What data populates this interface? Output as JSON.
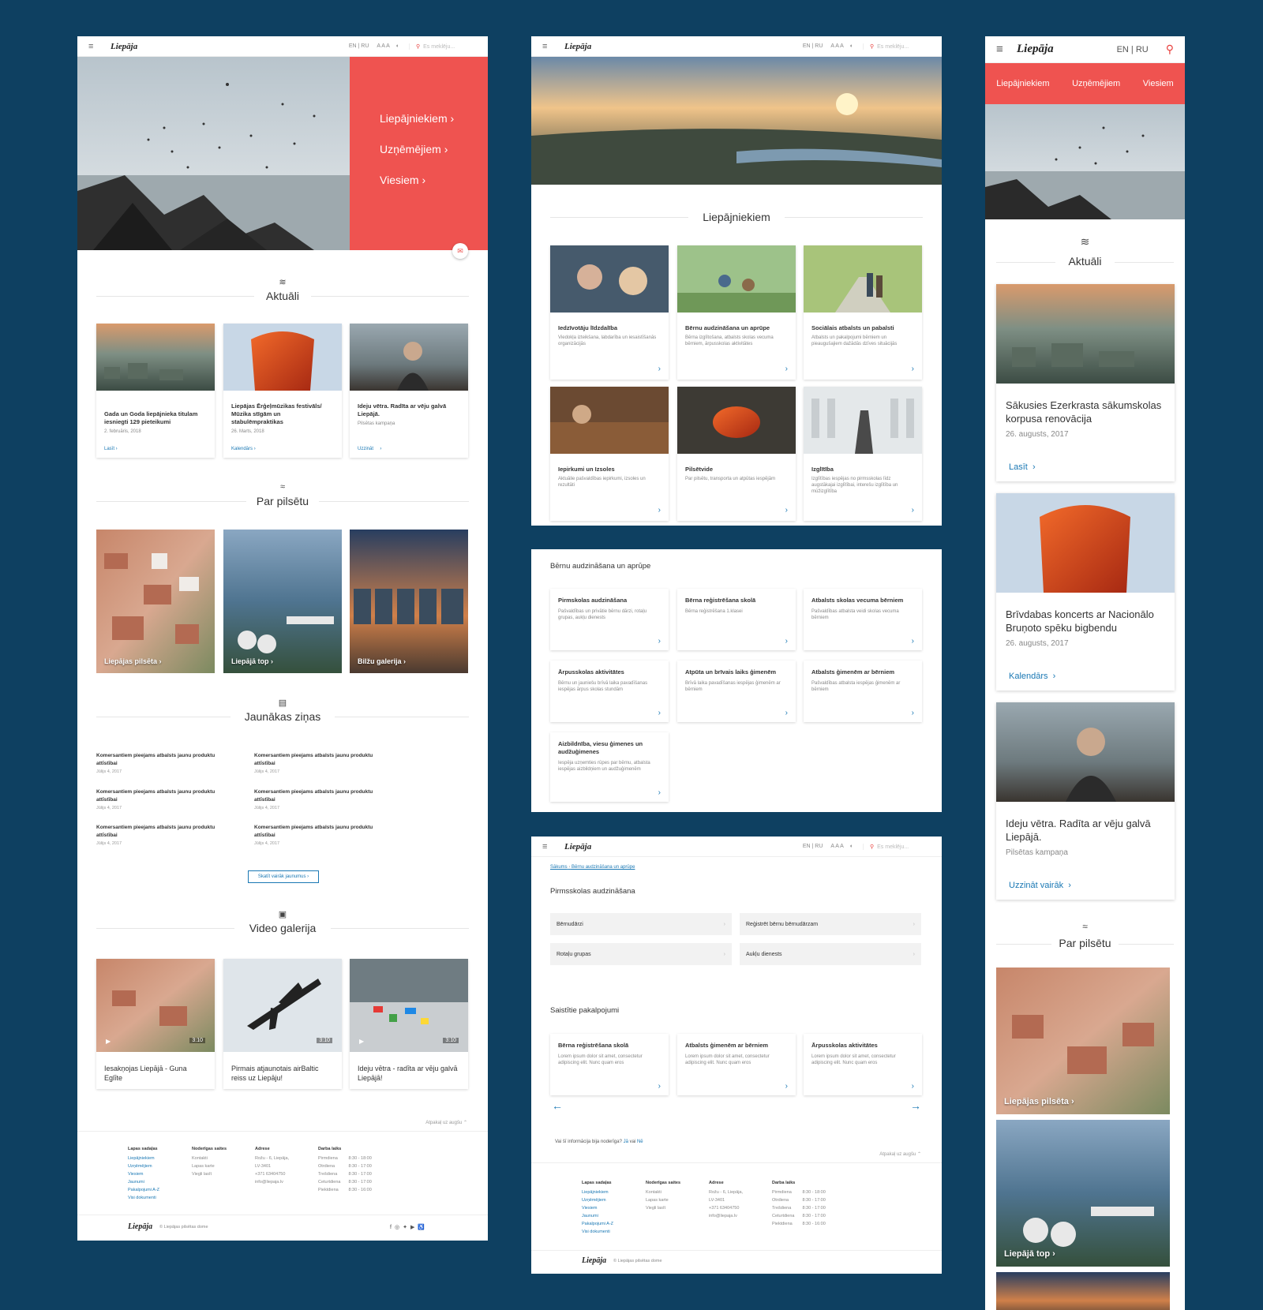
{
  "common": {
    "logo": "Liepāja",
    "lang_en": "EN",
    "lang_ru": "RU",
    "aaa": "A A A",
    "search_placeholder": "Es meklēju..."
  },
  "colors": {
    "accent": "#ef5350",
    "link": "#1a78b4",
    "background": "#0e4061"
  },
  "board1": {
    "hero_nav": [
      "Liepājniekiem",
      "Uzņēmējiem",
      "Viesiem"
    ],
    "aktuali_title": "Aktuāli",
    "aktuali_cards": [
      {
        "title": "Gada un Goda liepājnieka titulam iesniegti 129 pieteikumi",
        "date": "2. februāris, 2018",
        "link": "Lasīt"
      },
      {
        "title": "Liepājas Ērģeļmūzikas festivāls/ Mūzika stīgām un stabulēmpraktikas",
        "date": "26. Marts, 2018",
        "link": "Kalendārs"
      },
      {
        "title": "Ideju vētra. Radīta ar vēju galvā Liepājā.",
        "date": "Pilsētas kampaņa",
        "link": "Uzzināt"
      }
    ],
    "par_title": "Par pilsētu",
    "par_tiles": [
      "Liepājas pilsēta",
      "Liepājā top",
      "Bilžu galerija"
    ],
    "news_title": "Jaunākas ziņas",
    "news_item": "Komersantiem pieejams atbalsts jaunu produktu attīstībai",
    "news_date": "Jūlijs 4, 2017",
    "news_more": "Skatīt vairāk jaunumus",
    "video_title": "Video galerija",
    "videos": [
      {
        "title": "Iesakņojas Liepājā - Guna Eglīte",
        "dur": "3:10"
      },
      {
        "title": "Pirmais atjaunotais airBaltic reiss uz Liepāju!",
        "dur": "3:10"
      },
      {
        "title": "Ideju vētra - radīta ar vēju galvā Liepājā!",
        "dur": "3:10"
      }
    ],
    "back_top": "Atpakaļ uz augšu",
    "footer": {
      "col1_title": "Lapas sadaļas",
      "col1": [
        "Liepājniekiem",
        "Uzņēmējiem",
        "Viesiem",
        "Jaunumi",
        "Pakalpojumi A-Z",
        "Visi dokumenti"
      ],
      "col2_title": "Noderīgas saites",
      "col2": [
        "Kontakti",
        "Lapas karte",
        "Viegli lasīt"
      ],
      "col3_title": "Adrese",
      "col3": [
        "Rožu - 6, Liepāja,",
        "LV-3401",
        "+371 63404750",
        "info@liepaja.lv"
      ],
      "col4_title": "Darba laiks",
      "days": [
        "Pirmdiena",
        "Otrdiena",
        "Trešdiena",
        "Ceturtdiena",
        "Piektdiena"
      ],
      "hours": [
        "8:30 - 18:00",
        "8:30 - 17:00",
        "8:30 - 17:00",
        "8:30 - 17:00",
        "8:30 - 16:00"
      ],
      "council": "Liepājas pilsētas dome"
    }
  },
  "board2": {
    "title": "Liepājniekiem",
    "cards": [
      {
        "title": "Iedzīvotāju līdzdalība",
        "desc": "Viedokļa izteikšana, labdarība un iesaistīšanās organizācijās"
      },
      {
        "title": "Bērnu audzināšana un aprūpe",
        "desc": "Bērna izglītošana, atbalsts skolas vecuma bērniem, ārpusskolas aktivitātes"
      },
      {
        "title": "Sociālais atbalsts un pabalsti",
        "desc": "Atbalsts un pakalpojumi bērniem un pieaugušajiem dažādās dzīves situācijās"
      },
      {
        "title": "Iepirkumi un Izsoles",
        "desc": "Aktuālie pašvaldības iepirkumi, izsoles un rezultāti"
      },
      {
        "title": "Pilsētvide",
        "desc": "Par pilsētu, transporta un atpūtas iespējām"
      },
      {
        "title": "Izglītība",
        "desc": "Izglītības iespējas no pirmsskolas līdz augstākajai izglītībai, interešu izglītība un mūžizglītība"
      }
    ]
  },
  "board3": {
    "title": "Bērnu audzināšana un aprūpe",
    "cards": [
      {
        "title": "Pirmskolas audzināšana",
        "desc": "Pašvaldības un privātie bērnu dārzi, rotaļu grupas, aukļu dienests"
      },
      {
        "title": "Bērna reģistrēšana skolā",
        "desc": "Bērna reģistrēšana 1.klasei"
      },
      {
        "title": "Atbalsts skolas vecuma bērniem",
        "desc": "Pašvaldības atbalsta veidi skolas vecuma bērniem"
      },
      {
        "title": "Ārpusskolas aktivitātes",
        "desc": "Bērnu un jauniešu brīvā laika pavadīšanas iespējas ārpus skolas stundām"
      },
      {
        "title": "Atpūta un brīvais laiks ģimenēm",
        "desc": "Brīvā laika pavadīšanas iespējas ģimenēm ar bērniem"
      },
      {
        "title": "Atbalsts ģimenēm ar bērniem",
        "desc": "Pašvaldības atbalsta iespējas ģimenēm ar bērniem"
      },
      {
        "title": "Aizbildnība, viesu ģimenes un audžuģimenes",
        "desc": "Iespēja uzņemties rūpes par bērnu, atbalsta iespējas aizbildņiem un audžuģimenēm"
      }
    ]
  },
  "board4": {
    "crumb_home": "Sākums",
    "crumb_page": "Bērnu audzināšana un aprūpe",
    "title": "Pirmsskolas audzināšana",
    "buttons": [
      "Bērnudārzi",
      "Reģistrēt bērnu bērnudārzam",
      "Rotaļu grupas",
      "Aukļu dienests"
    ],
    "related_title": "Saistītie pakalpojumi",
    "related": [
      "Bērna reģistrēšana skolā",
      "Atbalsts ģimenēm ar bērniem",
      "Ārpusskolas aktivitātes"
    ],
    "lorem": "Lorem ipsum dolor sit amet, consectetur adipiscing elit. Nunc quam eros",
    "feedback_q": "Vai šī informācija bija noderīga?",
    "yes": "Jā",
    "or": "vai",
    "no": "Nē"
  },
  "board5": {
    "lang_en": "EN",
    "lang_ru": "RU",
    "nav": [
      "Liepājniekiem",
      "Uzņēmējiem",
      "Viesiem"
    ],
    "aktuali_title": "Aktuāli",
    "cards": [
      {
        "title": "Sākusies Ezerkrasta sākumskolas korpusa renovācija",
        "date": "26. augusts, 2017",
        "link": "Lasīt"
      },
      {
        "title": "Brīvdabas koncerts ar Nacionālo Bruņoto spēku bigbendu",
        "date": "26. augusts, 2017",
        "link": "Kalendārs"
      },
      {
        "title": "Ideju vētra. Radīta ar vēju galvā Liepājā.",
        "date": "Pilsētas kampaņa",
        "link": "Uzzināt vairāk"
      }
    ],
    "par_title": "Par pilsētu",
    "tiles": [
      "Liepājas pilsēta",
      "Liepājā top"
    ]
  }
}
